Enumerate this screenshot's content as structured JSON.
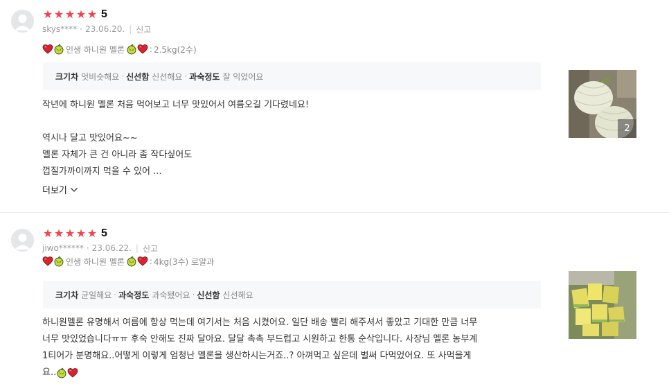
{
  "reviews": [
    {
      "score": "5",
      "user": "skys****",
      "date": "23.06.20.",
      "report": "신고",
      "option_text": "인생 하니원 멜론",
      "option_weight": "2.5kg(2수)",
      "attrs": [
        {
          "key": "크기차",
          "value": "엇비슷해요"
        },
        {
          "key": "신선함",
          "value": "신선해요"
        },
        {
          "key": "과숙정도",
          "value": "잘 익었어요"
        }
      ],
      "body": [
        "작년에 하니원 멜론 처음 먹어보고 너무 맛있어서 여름오길 기다렸네요!",
        "역시나 달고 맛있어요~~",
        "멜론 자체가 큰 건 아니라 좀 작다싶어도",
        "껍질가까이까지 먹을 수 있어 ..."
      ],
      "more": "더보기",
      "photo_count": "2"
    },
    {
      "score": "5",
      "user": "jiwo******",
      "date": "23.06.22.",
      "report": "신고",
      "option_text": "인생 하니원 멜론",
      "option_weight": "4kg(3수) 로얄과",
      "attrs": [
        {
          "key": "크기차",
          "value": "균일해요"
        },
        {
          "key": "과숙정도",
          "value": "과숙됐어요"
        },
        {
          "key": "신선함",
          "value": "신선해요"
        }
      ],
      "body": [
        "하니원멜론 유명해서 여름에 항상 먹는데 여기서는 처음 시켰어요. 일단 배송 빨리 해주셔서 좋았고 기대한 만큼 너무",
        "너무 맛있었습니다ㅠㅠ 후숙 안해도 진짜 달아요. 달달 촉촉 부드럽고 시원하고 한통 순삭입니다. 사장님 멜론 농부계",
        "1티어가 분명해요..어떻게 이렇게 엄청난 멜론을 생산하시는거죠..? 아껴먹고 싶은데 벌써 다먹었어요. 또 사먹을게",
        "요.."
      ]
    }
  ],
  "colors": {
    "star": "#f2414b",
    "attr_bg": "#f7f8fa",
    "meta": "#9a9a9a"
  }
}
